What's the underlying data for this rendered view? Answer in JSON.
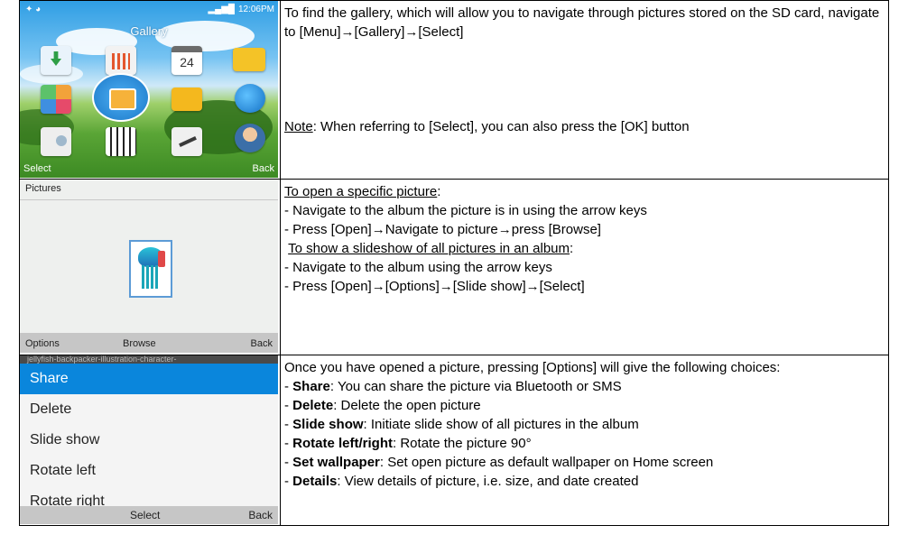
{
  "screen1": {
    "time": "12:06PM",
    "title": "Gallery",
    "calendar_day": "24",
    "left_softkey": "Select",
    "right_softkey": "Back",
    "icons": [
      "download-icon",
      "equalizer-icon",
      "calendar-icon",
      "mail-icon",
      "apps-grid-icon",
      "gallery-icon",
      "folder-icon",
      "globe-icon",
      "radio-icon",
      "piano-icon",
      "settings-icon",
      "contacts-icon"
    ]
  },
  "screen2": {
    "header": "Pictures",
    "left_softkey": "Options",
    "center_softkey": "Browse",
    "right_softkey": "Back"
  },
  "screen3": {
    "file_name": "jellyfish-backpacker-illustration-character-",
    "options": [
      "Share",
      "Delete",
      "Slide show",
      "Rotate left",
      "Rotate right"
    ],
    "selected": "Share",
    "center_softkey": "Select",
    "right_softkey": "Back"
  },
  "row1": {
    "text1": "To find the gallery, which will allow you to navigate through pictures stored on the SD card, navigate to [Menu]→[Gallery]→[Select]",
    "note_label": "Note",
    "note_text": ": When referring to [Select], you can also press the [OK] button"
  },
  "row2": {
    "heading1": "To open a specific picture",
    "colon1": ":",
    "line1": "- Navigate to the album the picture is in using the arrow keys",
    "line2": "- Press [Open]→Navigate to picture→press [Browse]",
    "heading2": "To show a slideshow of all pictures in an album",
    "colon2": ":",
    "line3": "- Navigate to the album using the arrow keys",
    "line4": "- Press [Open]→[Options]→[Slide show]→[Select]"
  },
  "row3": {
    "intro": "Once you have opened a picture, pressing [Options] will give the following choices:",
    "items": [
      {
        "label": "Share",
        "text": ": You can share the picture via Bluetooth or SMS"
      },
      {
        "label": "Delete",
        "text": ": Delete the open picture"
      },
      {
        "label": "Slide show",
        "text": ": Initiate slide show of all pictures in the album"
      },
      {
        "label": "Rotate left/right",
        "text": ": Rotate the picture 90°"
      },
      {
        "label": "Set wallpaper",
        "text": ": Set open picture as default wallpaper on Home screen"
      },
      {
        "label": "Details",
        "text": ": View details of picture, i.e. size, and date created"
      }
    ]
  }
}
